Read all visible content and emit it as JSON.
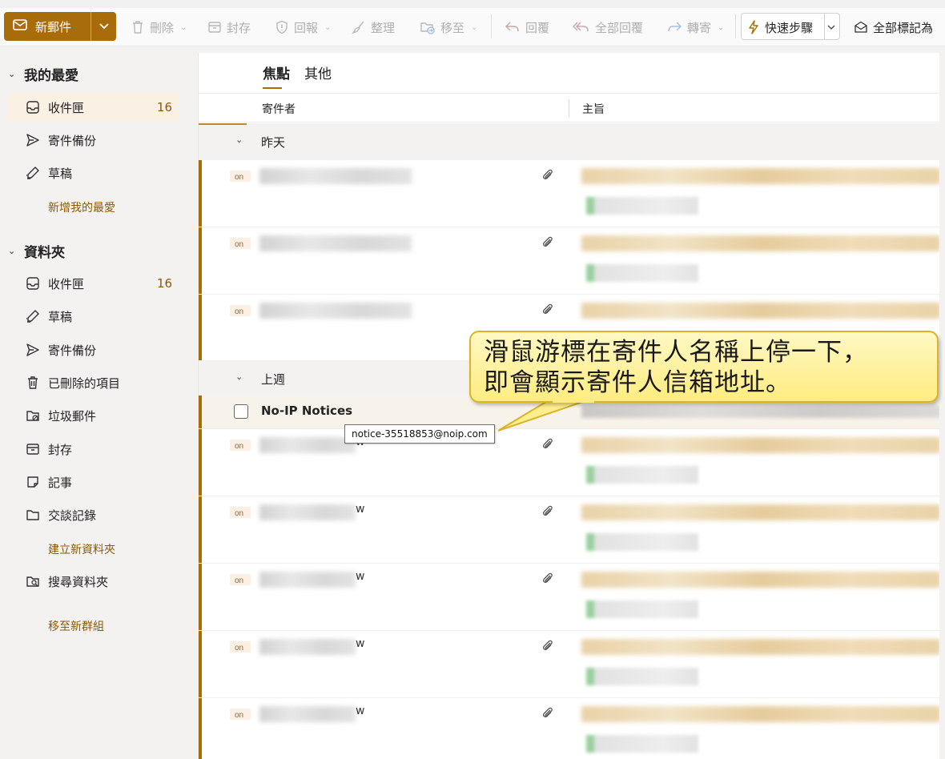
{
  "toolbar": {
    "new_mail": "新郵件",
    "delete": "刪除",
    "archive": "封存",
    "report": "回報",
    "sweep": "整理",
    "move_to": "移至",
    "reply": "回覆",
    "reply_all": "全部回覆",
    "forward": "轉寄",
    "quick_steps": "快速步驟",
    "mark_all_read": "全部標記為"
  },
  "sidebar": {
    "favorites_title": "我的最愛",
    "favorites": [
      {
        "label": "收件匣",
        "count": "16",
        "icon": "inbox-icon"
      },
      {
        "label": "寄件備份",
        "count": "",
        "icon": "sent-icon"
      },
      {
        "label": "草稿",
        "count": "",
        "icon": "drafts-icon"
      }
    ],
    "add_favorite": "新增我的最愛",
    "folders_title": "資料夾",
    "folders": [
      {
        "label": "收件匣",
        "count": "16",
        "icon": "inbox-icon"
      },
      {
        "label": "草稿",
        "count": "",
        "icon": "drafts-icon"
      },
      {
        "label": "寄件備份",
        "count": "",
        "icon": "sent-icon"
      },
      {
        "label": "已刪除的項目",
        "count": "",
        "icon": "trash-icon"
      },
      {
        "label": "垃圾郵件",
        "count": "",
        "icon": "junk-icon"
      },
      {
        "label": "封存",
        "count": "",
        "icon": "archive-icon"
      },
      {
        "label": "記事",
        "count": "",
        "icon": "note-icon"
      },
      {
        "label": "交談記錄",
        "count": "",
        "icon": "folder-icon"
      }
    ],
    "create_folder": "建立新資料夾",
    "search_folder": "搜尋資料夾",
    "new_group": "移至新群組"
  },
  "mail_list": {
    "tabs": [
      "焦點",
      "其他"
    ],
    "col_sender": "寄件者",
    "col_subject": "主旨",
    "group_yesterday": "昨天",
    "group_last_week": "上週",
    "highlighted_sender": "No-IP Notices",
    "row_suffix": "w"
  },
  "tooltip": "notice-35518853@noip.com",
  "callout": {
    "line1": "滑鼠游標在寄件人名稱上停一下，",
    "line2": "即會顯示寄件人信箱地址。"
  },
  "colors": {
    "accent": "#a86c0b",
    "callout_bg": "#fff3a0",
    "callout_border": "#d9b32a"
  }
}
